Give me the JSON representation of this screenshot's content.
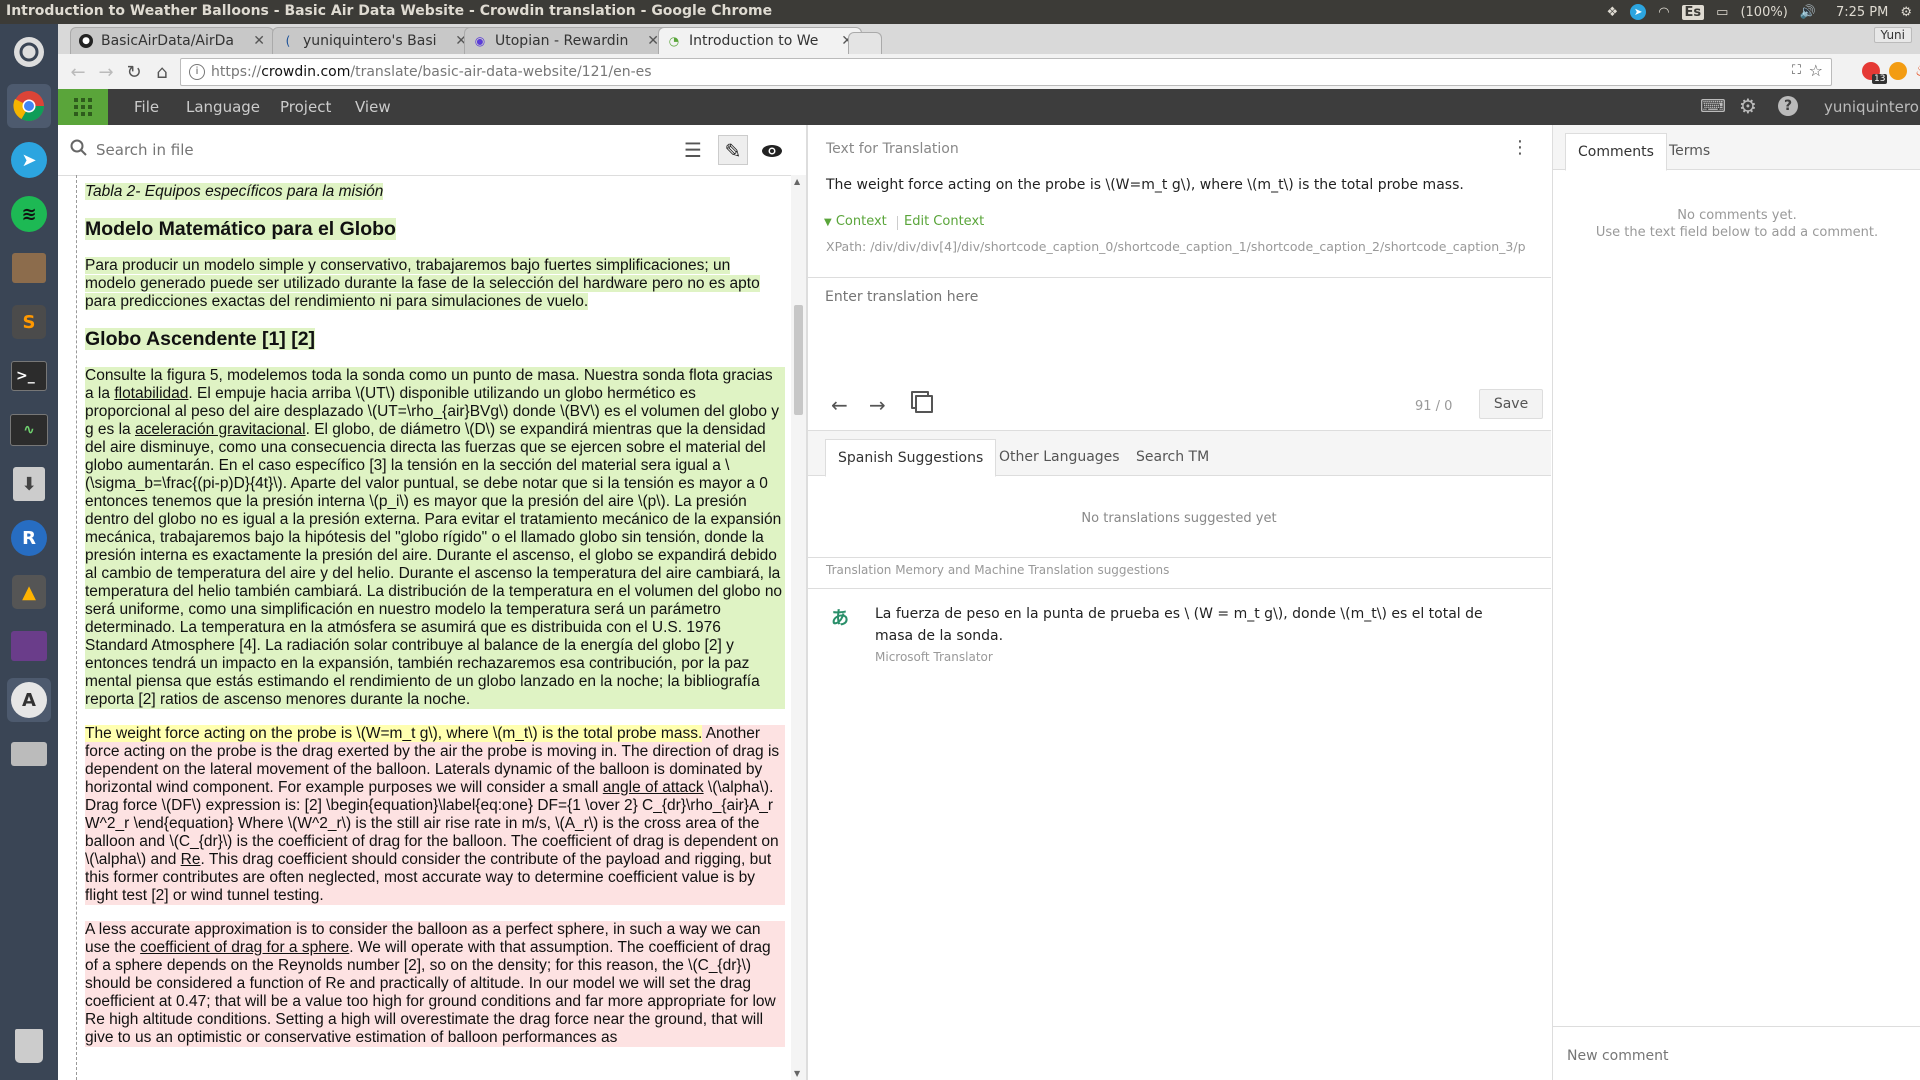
{
  "system": {
    "window_title": "Introduction to Weather Balloons - Basic Air Data Website - Crowdin translation - Google Chrome",
    "language_indicator": "Es",
    "battery": "(100%)",
    "time": "7:25 PM"
  },
  "browser": {
    "tabs": [
      {
        "label": "BasicAirData/AirDa",
        "active": false
      },
      {
        "label": "yuniquintero's Basi",
        "active": false
      },
      {
        "label": "Utopian - Rewardin",
        "active": false
      },
      {
        "label": "Introduction to We",
        "active": true
      }
    ],
    "profile": "Yuni",
    "url_prefix": "https://",
    "url_host": "crowdin.com",
    "url_path": "/translate/basic-air-data-website/121/en-es",
    "extension_badge": "13"
  },
  "crowdin": {
    "menu": [
      "File",
      "Language",
      "Project",
      "View"
    ],
    "username": "yuniquintero"
  },
  "left": {
    "search_placeholder": "Search in file",
    "doc": {
      "caption": "Tabla 2- Equipos específicos para la misión",
      "heading1": "Modelo Matemático para el Globo",
      "p1": "Para producir un modelo simple y conservativo, trabajaremos bajo fuertes simplificaciones; un modelo generado puede ser utilizado durante la fase de la selección del hardware pero no es apto para predicciones exactas del rendimiento ni para simulaciones de vuelo.",
      "heading2": "Globo Ascendente [1] [2]",
      "p2_a": "Consulte la figura 5, modelemos toda la sonda como un punto de masa. Nuestra sonda flota gracias a la ",
      "p2_link1": "flotabilidad",
      "p2_b": ". El empuje hacia arriba \\(UT\\) disponible utilizando un globo hermético es proporcional al peso del aire desplazado \\(UT=\\rho_{air}BVg\\) donde \\(BV\\) es el volumen del globo y g es la ",
      "p2_link2": "aceleración gravitacional",
      "p2_c": ". El globo, de diámetro \\(D\\) se expandirá mientras que la densidad del aire disminuye, como una consecuencia directa las fuerzas que se ejercen sobre el material del globo aumentarán. En el caso específico [3] la tensión en la sección del material sera igual a \\(\\sigma_b=\\frac{(pi-p)D}{4t}\\). Aparte del valor puntual, se debe notar que si la tensión es mayor a 0 entonces tenemos que la presión interna \\(p_i\\) es mayor que la presión del aire \\(p\\). La presión dentro del globo no es igual a la presión externa. Para evitar el tratamiento mecánico de la expansión mecánica, trabajaremos bajo la hipótesis del \"globo rígido\" o el llamado globo sin tensión, donde la presión interna es exactamente la presión del aire. Durante el ascenso, el globo se expandirá debido al cambio de temperatura del aire y del helio. Durante el ascenso la temperatura del aire cambiará, la temperatura del helio también cambiará. La distribución de la temperatura en el volumen del globo no será uniforme, como una simplificación en nuestro modelo la temperatura será un parámetro determinado. La temperatura en la atmósfera se asumirá que es distribuida con el U.S. 1976 Standard Atmosphere [4]. La radiación solar contribuye al balance de la energía del globo [2] y entonces tendrá un impacto en la expansión, también rechazaremos esa contribución, por la paz mental piensa que estás estimando el rendimiento de un globo lanzado en la noche; la bibliografía reporta [2] ratios de ascenso menores durante la noche.",
      "p3_sel": "The weight force acting on the probe is \\(W=m_t g\\), where \\(m_t\\) is the total probe mass.",
      "p3_a": " Another force acting on the probe is the drag exerted by the air the probe is moving in. The direction of drag is dependent on the lateral movement of the balloon. Laterals dynamic of the balloon is dominated by horizontal wind component. For example purposes we will consider a small ",
      "p3_link1": "angle of attack",
      "p3_b": " \\(\\alpha\\). Drag force \\(DF\\) expression is: [2] \\begin{equation}\\label{eq:one} DF={1 \\over 2} C_{dr}\\rho_{air}A_r W^2_r \\end{equation} Where \\(W^2_r\\) is the still air rise rate in m/s, \\(A_r\\) is the cross area of the balloon and \\(C_{dr}\\) is the coefficient of drag for the balloon. The coefficient of drag is dependent on \\(\\alpha\\) and ",
      "p3_link2": "Re",
      "p3_c": ". This drag coefficient should consider the contribute of the payload and rigging, but this former contributes are often neglected, most accurate way to determine coefficient value is by flight test [2] or wind tunnel testing.",
      "p4_a": "A less accurate approximation is to consider the balloon as a perfect sphere, in such a way we can use the ",
      "p4_link": "coefficient of drag for a sphere",
      "p4_b": ". We will operate with that assumption. The coefficient of drag of a sphere depends on the Reynolds number [2], so on the density; for this reason, the \\(C_{dr}\\) should be considered a function of Re and practically of altitude. In our model we will set the drag coefficient at 0.47; that will be a value too high for ground conditions and far more appropriate for low Re high altitude conditions. Setting a high will overestimate the drag force near the ground, that will give to us an optimistic or conservative estimation of balloon performances as"
    }
  },
  "middle": {
    "header": "Text for Translation",
    "source_text": "The weight force acting on the probe is \\(W=m_t g\\), where \\(m_t\\) is the total probe mass.",
    "context_label": "Context",
    "edit_context_label": "Edit Context",
    "xpath": "XPath: /div/div/div[4]/div/shortcode_caption_0/shortcode_caption_1/shortcode_caption_2/shortcode_caption_3/p",
    "translation_placeholder": "Enter translation here",
    "counter": "91 / 0",
    "save_label": "Save",
    "tabs": [
      "Spanish Suggestions",
      "Other Languages",
      "Search TM"
    ],
    "no_suggestions": "No translations suggested yet",
    "tm_header": "Translation Memory and Machine Translation suggestions",
    "mt_text": "La fuerza de peso en la punta de prueba es \\ (W = m_t g\\), donde \\(m_t\\) es el total de masa de la sonda.",
    "mt_source": "Microsoft Translator"
  },
  "right": {
    "tabs": [
      "Comments",
      "Terms"
    ],
    "no_comments": "No comments yet.",
    "hint": "Use the text field below to add a comment.",
    "new_comment_placeholder": "New comment"
  },
  "colors": {
    "crowdin_green": "#5aa53a",
    "header_dark": "#3d3d3d",
    "approved_bg": "#dff3c4",
    "selected_bg": "#ffffb0",
    "untranslated_bg": "#fde2e2"
  }
}
